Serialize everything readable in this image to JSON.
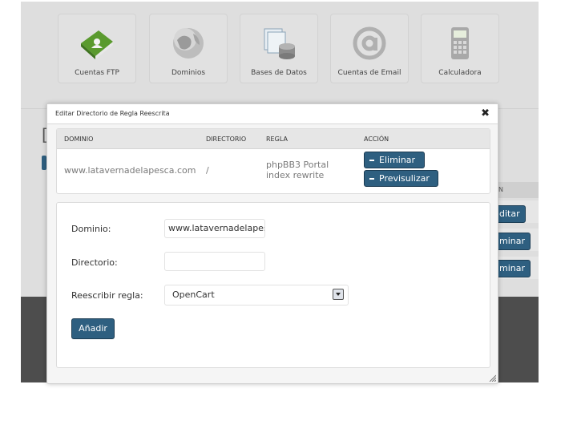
{
  "background": {
    "icons": [
      {
        "label": "Cuentas FTP",
        "icon": "ftp-book-icon"
      },
      {
        "label": "Dominios",
        "icon": "globe-icon"
      },
      {
        "label": "Bases de Datos",
        "icon": "database-icon"
      },
      {
        "label": "Cuentas de Email",
        "icon": "at-sign-icon"
      },
      {
        "label": "Calculadora",
        "icon": "calculator-icon"
      }
    ],
    "partial_column_header": "N",
    "partial_buttons": [
      "ditar",
      "minar",
      "minar"
    ]
  },
  "dialog": {
    "title": "Editar Directorio de Regla Reescrita",
    "close_symbol": "✖",
    "table": {
      "headers": [
        "DOMINIO",
        "DIRECTORIO",
        "REGLA",
        "ACCIÓN"
      ],
      "row": {
        "domain": "www.latavernadelapesca.com",
        "directory": "/",
        "rule_line1": "phpBB3 Portal",
        "rule_line2": "index rewrite",
        "actions": [
          "Eliminar",
          "Previsulizar"
        ]
      }
    },
    "form": {
      "domain_label": "Dominio:",
      "domain_value": "www.latavernadelapesca.com",
      "directory_label": "Directorio:",
      "directory_value": "",
      "rule_label": "Reescribir regla:",
      "rule_selected": "OpenCart",
      "submit_label": "Añadir"
    }
  },
  "colors": {
    "button_blue": "#2e5f80",
    "background_gray": "#dedede",
    "dark_band": "#4d4d4d"
  }
}
